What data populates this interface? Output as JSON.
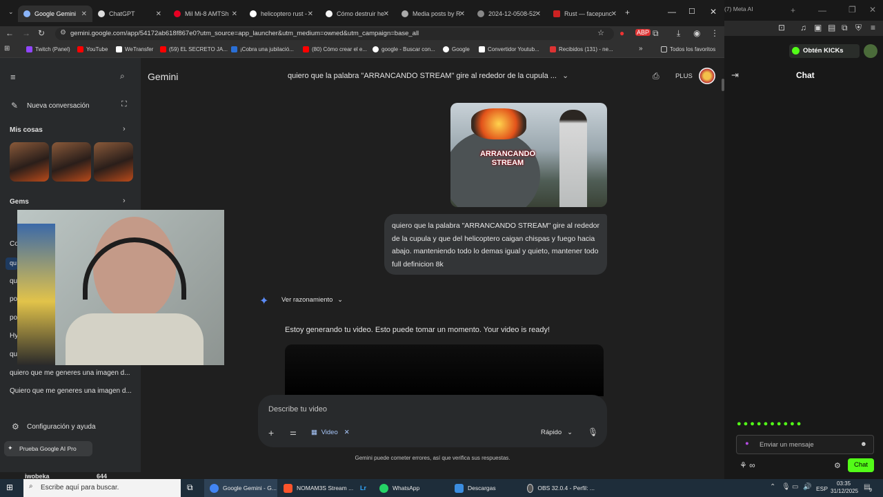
{
  "browser": {
    "tabs": [
      {
        "label": "Google Gemini",
        "color": "#8ab4f8",
        "active": true
      },
      {
        "label": "ChatGPT",
        "color": "#dddddd"
      },
      {
        "label": "Mil Mi-8 AMTSh",
        "color": "#e60023"
      },
      {
        "label": "helicoptero rust -",
        "color": "#ffffff"
      },
      {
        "label": "Cómo destruir he",
        "color": "#f5f5f5"
      },
      {
        "label": "Media posts by R",
        "color": "#aaaaaa"
      },
      {
        "label": "2024-12-0508-52",
        "color": "#888888"
      },
      {
        "label": "Rust — facepunc",
        "color": "#cc2222"
      }
    ],
    "url": "gemini.google.com/app/54172ab618f867e0?utm_source=app_launcher&utm_medium=owned&utm_campaign=base_all",
    "bookmarks": [
      {
        "label": "Twitch (Panel)",
        "color": "#9146ff"
      },
      {
        "label": "YouTube",
        "color": "#ff0000"
      },
      {
        "label": "WeTransfer",
        "color": "#ffffff"
      },
      {
        "label": "(59) EL SECRETO JA...",
        "color": "#ff0000"
      },
      {
        "label": "¡Cobra una jubilació...",
        "color": "#2a6fd6"
      },
      {
        "label": "(80) Cómo crear el e...",
        "color": "#ff0000"
      },
      {
        "label": "google - Buscar con...",
        "color": "#ffffff"
      },
      {
        "label": "Google",
        "color": "#ffffff"
      },
      {
        "label": "Convertidor Youtub...",
        "color": "#ffffff"
      },
      {
        "label": "Recibidos (131) - ne...",
        "color": "#d33"
      }
    ],
    "all_bookmarks": "Todos los favoritos",
    "bookmark_more": "»"
  },
  "sidebar": {
    "new_chat": "Nueva conversación",
    "my_stuff": "Mis cosas",
    "gems": "Gems",
    "partial_items": [
      "Co",
      "qu",
      "qu",
      "po",
      "po",
      "Hy",
      "qu"
    ],
    "recent": [
      "quiero que me generes una imagen d...",
      "Quiero que me generes una imagen d..."
    ],
    "settings": "Configuración y ayuda",
    "promo": "Prueba Google AI Pro",
    "bottom_user": "iwobeka",
    "bottom_count": "644"
  },
  "header": {
    "app": "Gemini",
    "title": "quiero que la palabra \"ARRANCANDO STREAM\" gire al rededor de la cupula ...",
    "plan": "PLUS"
  },
  "conversation": {
    "image_text": "ARRANCANDO STREAM",
    "user_message": "quiero que la palabra \"ARRANCANDO STREAM\" gire al rededor de la cupula y que del helicoptero caigan chispas y fuego hacia abajo. manteniendo todo lo demas igual y quieto, mantener todo full definicion 8k",
    "reasoning": "Ver razonamiento",
    "response": "Estoy generando tu video. Esto puede tomar un momento. Your video is ready!"
  },
  "composer": {
    "placeholder": "Describe tu video",
    "chip": "Video",
    "mode": "Rápido",
    "disclaimer": "Gemini puede cometer errores, así que verifica sus respuestas."
  },
  "right_panel": {
    "tab_label": "(7) Meta AI",
    "kick_button": "Obtén KICKs",
    "chat_title": "Chat",
    "message_placeholder": "Enviar un mensaje",
    "infinity": "∞",
    "chat_button": "Chat",
    "accent": "#53fc18"
  },
  "taskbar": {
    "search": "Escribe aquí para buscar.",
    "apps": [
      {
        "label": "Google Gemini - G...",
        "color": "#4285f4"
      },
      {
        "label": "NOMAM3S Stream ...",
        "color": "#fb542b"
      },
      {
        "label": "",
        "color": "#31a8ff"
      },
      {
        "label": "WhatsApp",
        "color": "#25d366"
      },
      {
        "label": "Descargas",
        "color": "#3b8de0"
      },
      {
        "label": "OBS 32.0.4 - Perfil: ...",
        "color": "#555555"
      }
    ],
    "lang": "ESP",
    "time": "03:35",
    "date": "31/12/2025",
    "notif": "9"
  }
}
